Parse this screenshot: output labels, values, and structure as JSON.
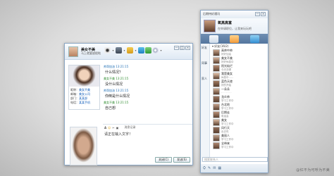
{
  "chat": {
    "title_name": "美女不美",
    "title_signature": "马上就要放假啦",
    "toolbar_icons": [
      "video-call-icon",
      "voice-call-icon",
      "file-transfer-icon",
      "remote-assist-icon",
      "app-icon",
      "settings-icon"
    ],
    "window_buttons": [
      "—",
      "□",
      "×"
    ],
    "info": [
      {
        "label": "昵称：",
        "value": "美女不美"
      },
      {
        "label": "邮箱：",
        "value": "美女公司"
      },
      {
        "label": "部门：",
        "value": "某某部"
      },
      {
        "label": "电话：",
        "value": "某某手机"
      }
    ],
    "messages": [
      {
        "sender": "帅哥加油",
        "time": "13:21:15",
        "text": "什么情况？",
        "me": false
      },
      {
        "sender": "美女不美",
        "time": "13:21:15",
        "text": "没什么情况",
        "me": true
      },
      {
        "sender": "帅哥加油",
        "time": "13:21:15",
        "text": "你倒是什么情况",
        "me": false
      },
      {
        "sender": "美女不美",
        "time": "13:21:15",
        "text": "自己想",
        "me": true
      }
    ],
    "format_bar": [
      "A",
      "☺",
      "✂",
      "▣",
      "消息记录"
    ],
    "input_text": "请正在输入文字！",
    "close_label": "关闭(C)",
    "send_label": "发送(S)"
  },
  "contacts": {
    "window_title": "后期待好通讯",
    "profile_name": "氧高高富",
    "profile_signature": "在申请职位，让我来玩玩吧",
    "side_labels": [
      "好友",
      "同事",
      "家人"
    ],
    "group_name": "▾ 好友(16/2)",
    "items": [
      {
        "name": "高帅中帅",
        "sig": "好好加油"
      },
      {
        "name": "美女不美",
        "sig": "好好休息中"
      },
      {
        "name": "阳光灿烂",
        "sig": "今天去哪"
      },
      {
        "name": "我是美女",
        "sig": "休息中……"
      },
      {
        "name": "蓝色天使",
        "sig": "好的开始"
      },
      {
        "name": "一朵朵",
        "sig": "· · · · · · ·"
      },
      {
        "name": "龙炎帅",
        "sig": "学习工作中"
      },
      {
        "name": "台北地",
        "sig": "学习工作中"
      },
      {
        "name": "后期走",
        "sig": "电话会"
      },
      {
        "name": "美女",
        "sig": "学习工作中"
      },
      {
        "name": "风行天",
        "sig": "出去吃"
      },
      {
        "name": "美丽人",
        "sig": "学习工作中"
      },
      {
        "name": "全带来",
        "sig": "学习工作中"
      }
    ],
    "search_placeholder": "搜索联系人",
    "bottom_icons": [
      "menu-icon",
      "tools-icon",
      "message-icon",
      "app-manager-icon"
    ]
  },
  "watermark": "@红不为可呼为不美"
}
